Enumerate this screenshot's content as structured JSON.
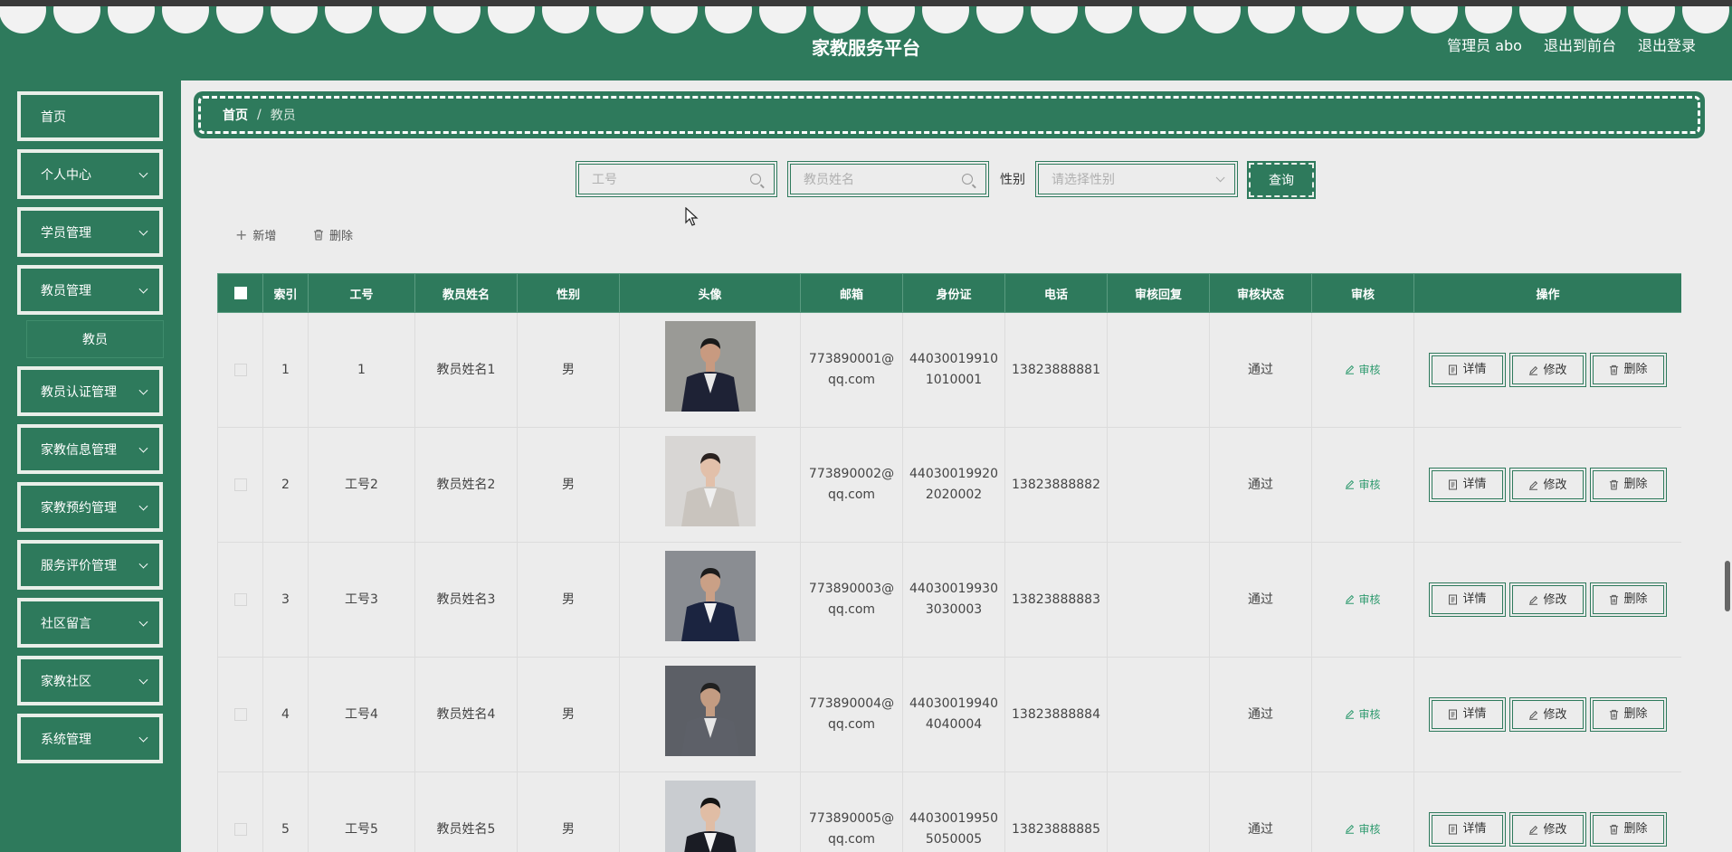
{
  "header": {
    "title": "家教服务平台",
    "links": [
      "管理员 abo",
      "退出到前台",
      "退出登录"
    ]
  },
  "sidebar": {
    "items": [
      {
        "label": "首页"
      },
      {
        "label": "个人中心"
      },
      {
        "label": "学员管理"
      },
      {
        "label": "教员管理"
      },
      {
        "label": "教员认证管理"
      },
      {
        "label": "家教信息管理"
      },
      {
        "label": "家教预约管理"
      },
      {
        "label": "服务评价管理"
      },
      {
        "label": "社区留言"
      },
      {
        "label": "家教社区"
      },
      {
        "label": "系统管理"
      }
    ],
    "sub_item": "教员"
  },
  "breadcrumb": {
    "home": "首页",
    "separator": "/",
    "current": "教员"
  },
  "search": {
    "job_no_placeholder": "工号",
    "name_placeholder": "教员姓名",
    "gender_label": "性别",
    "gender_placeholder": "请选择性别",
    "query_label": "查询"
  },
  "actions": {
    "add_label": "新增",
    "delete_label": "删除"
  },
  "table": {
    "headers": [
      "索引",
      "工号",
      "教员姓名",
      "性别",
      "头像",
      "邮箱",
      "身份证",
      "电话",
      "审核回复",
      "审核状态",
      "审核",
      "操作"
    ],
    "audit_label": "审核",
    "detail_label": "详情",
    "edit_label": "修改",
    "delete_label": "删除",
    "rows": [
      {
        "index": "1",
        "job_no": "1",
        "name": "教员姓名1",
        "gender": "男",
        "email_1": "773890001@",
        "email_2": "qq.com",
        "id_1": "44030019910",
        "id_2": "1010001",
        "phone": "13823888881",
        "reply": "",
        "status": "通过"
      },
      {
        "index": "2",
        "job_no": "工号2",
        "name": "教员姓名2",
        "gender": "男",
        "email_1": "773890002@",
        "email_2": "qq.com",
        "id_1": "44030019920",
        "id_2": "2020002",
        "phone": "13823888882",
        "reply": "",
        "status": "通过"
      },
      {
        "index": "3",
        "job_no": "工号3",
        "name": "教员姓名3",
        "gender": "男",
        "email_1": "773890003@",
        "email_2": "qq.com",
        "id_1": "44030019930",
        "id_2": "3030003",
        "phone": "13823888883",
        "reply": "",
        "status": "通过"
      },
      {
        "index": "4",
        "job_no": "工号4",
        "name": "教员姓名4",
        "gender": "男",
        "email_1": "773890004@",
        "email_2": "qq.com",
        "id_1": "44030019940",
        "id_2": "4040004",
        "phone": "13823888884",
        "reply": "",
        "status": "通过"
      },
      {
        "index": "5",
        "job_no": "工号5",
        "name": "教员姓名5",
        "gender": "男",
        "email_1": "773890005@",
        "email_2": "qq.com",
        "id_1": "44030019950",
        "id_2": "5050005",
        "phone": "13823888885",
        "reply": "",
        "status": "通过"
      }
    ]
  },
  "colors": {
    "primary": "#2e7a5c",
    "background": "#ececec",
    "accent_link": "#2e9a6e"
  }
}
